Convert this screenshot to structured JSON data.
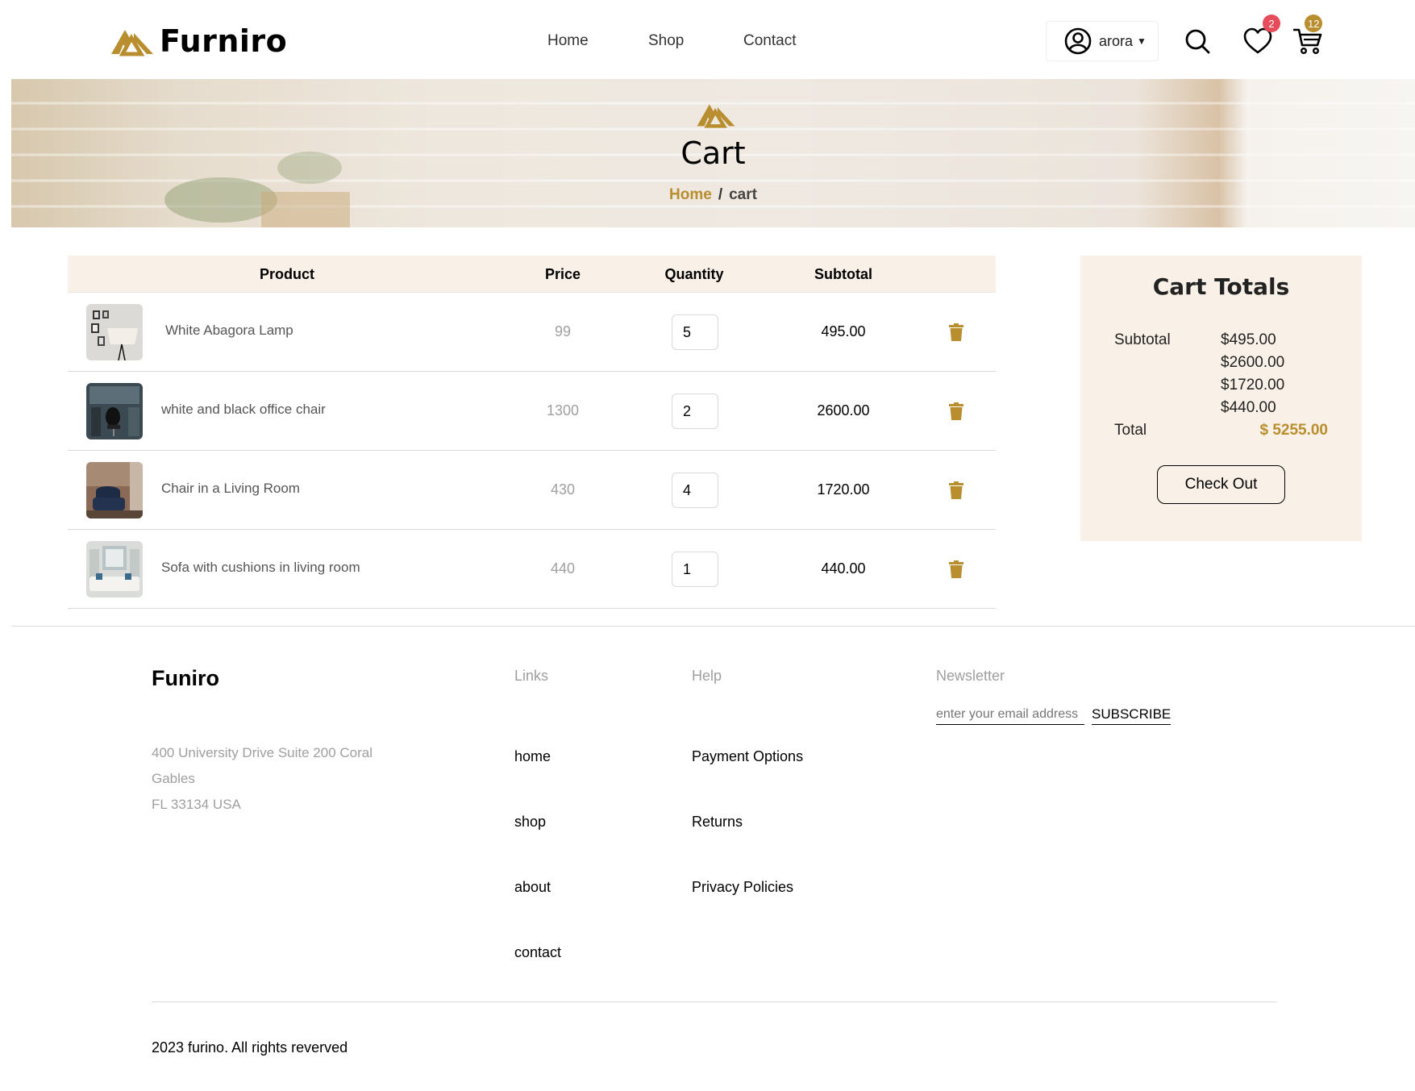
{
  "header": {
    "brand_name": "Furniro",
    "nav": [
      {
        "label": "Home"
      },
      {
        "label": "Shop"
      },
      {
        "label": "Contact"
      }
    ],
    "user_name": "arora",
    "wishlist_count": "2",
    "cart_count": "12",
    "icons": [
      "user-circle-icon",
      "search-icon",
      "heart-icon",
      "cart-icon"
    ]
  },
  "banner": {
    "title": "Cart",
    "breadcrumb": {
      "home": "Home",
      "separator": "/",
      "current": "cart"
    }
  },
  "cart": {
    "columns": [
      "Product",
      "Price",
      "Quantity",
      "Subtotal"
    ],
    "items": [
      {
        "name": "White Abagora Lamp",
        "price": "99",
        "quantity": "5",
        "subtotal": "495.00"
      },
      {
        "name": "white and black office chair",
        "price": "1300",
        "quantity": "2",
        "subtotal": "2600.00"
      },
      {
        "name": "Chair in a Living Room",
        "price": "430",
        "quantity": "4",
        "subtotal": "1720.00"
      },
      {
        "name": "Sofa with cushions in living room",
        "price": "440",
        "quantity": "1",
        "subtotal": "440.00"
      }
    ]
  },
  "totals": {
    "title": "Cart Totals",
    "subtotal_label": "Subtotal",
    "subtotals": [
      "$495.00",
      "$2600.00",
      "$1720.00",
      "$440.00"
    ],
    "total_label": "Total",
    "total_value": "$ 5255.00",
    "checkout_label": "Check Out"
  },
  "footer": {
    "brand": "Funiro",
    "address_lines": [
      "400 University Drive Suite 200 Coral Gables",
      "FL 33134 USA"
    ],
    "links_heading": "Links",
    "links": [
      "home",
      "shop",
      "about",
      "contact"
    ],
    "help_heading": "Help",
    "help": [
      "Payment Options",
      "Returns",
      "Privacy Policies"
    ],
    "newsletter_heading": "Newsletter",
    "newsletter_placeholder": "enter your email address",
    "subscribe_label": "SUBSCRIBE",
    "copyright": "2023 furino. All rights reverved"
  },
  "colors": {
    "accent": "#b88e2f",
    "panel": "#f9f1e7",
    "badge_red": "#e74c5a",
    "muted": "#9f9f9f"
  }
}
